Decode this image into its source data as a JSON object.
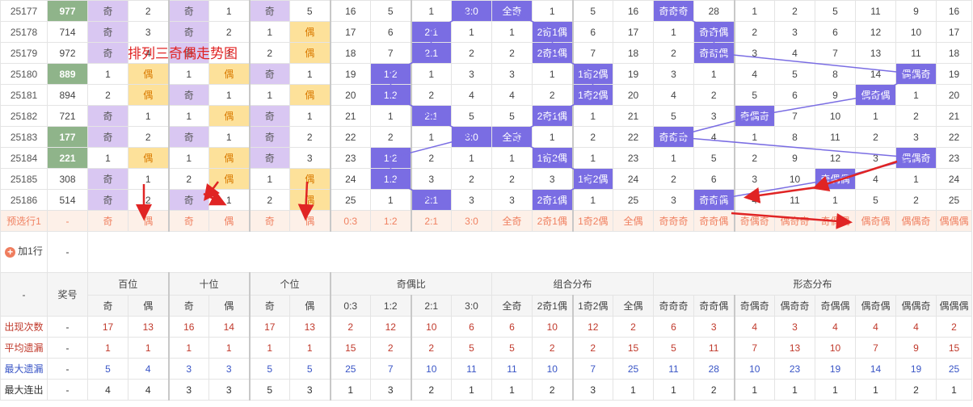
{
  "chart_title": "排列三奇偶走势图",
  "add_row": {
    "label": "加1行",
    "value": "-"
  },
  "rows": [
    {
      "issue": "25177",
      "lucky": "977",
      "lucky_hl": true,
      "c": [
        "奇",
        "2",
        "奇",
        "1",
        "奇",
        "5",
        "16",
        "5",
        "1",
        "3:0",
        "全奇",
        "1",
        "5",
        "16",
        "奇奇奇",
        "28",
        "1",
        "2",
        "5",
        "11",
        "9",
        "16"
      ],
      "hl": [
        0,
        2,
        4,
        9,
        10,
        14
      ]
    },
    {
      "issue": "25178",
      "lucky": "714",
      "lucky_hl": false,
      "c": [
        "奇",
        "3",
        "奇",
        "2",
        "1",
        "偶",
        "17",
        "6",
        "2:1",
        "1",
        "1",
        "2奇1偶",
        "6",
        "17",
        "1",
        "奇奇偶",
        "2",
        "3",
        "6",
        "12",
        "10",
        "17"
      ],
      "hl": [
        0,
        2,
        5,
        8,
        11,
        15
      ]
    },
    {
      "issue": "25179",
      "lucky": "972",
      "lucky_hl": false,
      "c": [
        "奇",
        "4",
        "奇",
        "1",
        "2",
        "偶",
        "18",
        "7",
        "2:1",
        "2",
        "2",
        "2奇1偶",
        "7",
        "18",
        "2",
        "奇奇偶",
        "3",
        "4",
        "7",
        "13",
        "11",
        "18"
      ],
      "hl": [
        0,
        2,
        5,
        8,
        11,
        15
      ]
    },
    {
      "issue": "25180",
      "lucky": "889",
      "lucky_hl": true,
      "c": [
        "1",
        "偶",
        "1",
        "偶",
        "奇",
        "1",
        "19",
        "1:2",
        "1",
        "3",
        "3",
        "1",
        "1奇2偶",
        "19",
        "3",
        "1",
        "4",
        "5",
        "8",
        "14",
        "偶偶奇",
        "19"
      ],
      "hl": [
        1,
        3,
        4,
        7,
        12,
        20
      ]
    },
    {
      "issue": "25181",
      "lucky": "894",
      "lucky_hl": false,
      "c": [
        "2",
        "偶",
        "奇",
        "1",
        "1",
        "偶",
        "20",
        "1:2",
        "2",
        "4",
        "4",
        "2",
        "1奇2偶",
        "20",
        "4",
        "2",
        "5",
        "6",
        "9",
        "偶奇偶",
        "1",
        "20"
      ],
      "hl": [
        1,
        2,
        5,
        7,
        12,
        19
      ]
    },
    {
      "issue": "25182",
      "lucky": "721",
      "lucky_hl": false,
      "c": [
        "奇",
        "1",
        "1",
        "偶",
        "奇",
        "1",
        "21",
        "1",
        "2:1",
        "5",
        "5",
        "2奇1偶",
        "1",
        "21",
        "5",
        "3",
        "奇偶奇",
        "7",
        "10",
        "1",
        "2",
        "21"
      ],
      "hl": [
        0,
        3,
        4,
        8,
        11,
        16
      ]
    },
    {
      "issue": "25183",
      "lucky": "177",
      "lucky_hl": true,
      "c": [
        "奇",
        "2",
        "奇",
        "1",
        "奇",
        "2",
        "22",
        "2",
        "1",
        "3:0",
        "全奇",
        "1",
        "2",
        "22",
        "奇奇奇",
        "4",
        "1",
        "8",
        "11",
        "2",
        "3",
        "22"
      ],
      "hl": [
        0,
        2,
        4,
        9,
        10,
        14
      ]
    },
    {
      "issue": "25184",
      "lucky": "221",
      "lucky_hl": true,
      "c": [
        "1",
        "偶",
        "1",
        "偶",
        "奇",
        "3",
        "23",
        "1:2",
        "2",
        "1",
        "1",
        "1奇2偶",
        "1",
        "23",
        "1",
        "5",
        "2",
        "9",
        "12",
        "3",
        "偶偶奇",
        "23"
      ],
      "hl": [
        1,
        3,
        4,
        7,
        11,
        20
      ]
    },
    {
      "issue": "25185",
      "lucky": "308",
      "lucky_hl": false,
      "c": [
        "奇",
        "1",
        "2",
        "偶",
        "1",
        "偶",
        "24",
        "1:2",
        "3",
        "2",
        "2",
        "3",
        "1奇2偶",
        "24",
        "2",
        "6",
        "3",
        "10",
        "奇偶偶",
        "4",
        "1",
        "24"
      ],
      "hl": [
        0,
        3,
        5,
        7,
        12,
        18
      ]
    },
    {
      "issue": "25186",
      "lucky": "514",
      "lucky_hl": false,
      "c": [
        "奇",
        "2",
        "奇",
        "1",
        "2",
        "偶",
        "25",
        "1",
        "2:1",
        "3",
        "3",
        "2奇1偶",
        "1",
        "25",
        "3",
        "奇奇偶",
        "4",
        "11",
        "1",
        "5",
        "2",
        "25"
      ],
      "hl": [
        0,
        2,
        5,
        8,
        11,
        15
      ]
    }
  ],
  "select_row": {
    "label": "预选行1",
    "dash": "-",
    "c": [
      "奇",
      "偶",
      "奇",
      "偶",
      "奇",
      "偶",
      "0:3",
      "1:2",
      "2:1",
      "3:0",
      "全奇",
      "2奇1偶",
      "1奇2偶",
      "全偶",
      "奇奇奇",
      "奇奇偶",
      "奇偶奇",
      "偶奇奇",
      "奇偶偶",
      "偶奇偶",
      "偶偶奇",
      "偶偶偶"
    ]
  },
  "header": {
    "dash": "-",
    "prize": "奖号",
    "groups": [
      {
        "label": "百位",
        "span": 2
      },
      {
        "label": "十位",
        "span": 2
      },
      {
        "label": "个位",
        "span": 2
      },
      {
        "label": "奇偶比",
        "span": 4
      },
      {
        "label": "组合分布",
        "span": 4
      },
      {
        "label": "形态分布",
        "span": 8
      }
    ],
    "sub": [
      "奇",
      "偶",
      "奇",
      "偶",
      "奇",
      "偶",
      "0:3",
      "1:2",
      "2:1",
      "3:0",
      "全奇",
      "2奇1偶",
      "1奇2偶",
      "全偶",
      "奇奇奇",
      "奇奇偶",
      "奇偶奇",
      "偶奇奇",
      "奇偶偶",
      "偶奇偶",
      "偶偶奇",
      "偶偶偶"
    ]
  },
  "stats": [
    {
      "label": "出现次数",
      "dash": "-",
      "tone": "red",
      "v": [
        "17",
        "13",
        "16",
        "14",
        "17",
        "13",
        "2",
        "12",
        "10",
        "6",
        "6",
        "10",
        "12",
        "2",
        "6",
        "3",
        "4",
        "3",
        "4",
        "4",
        "4",
        "2"
      ]
    },
    {
      "label": "平均遗漏",
      "dash": "-",
      "tone": "red",
      "v": [
        "1",
        "1",
        "1",
        "1",
        "1",
        "1",
        "15",
        "2",
        "2",
        "5",
        "5",
        "2",
        "2",
        "15",
        "5",
        "11",
        "7",
        "13",
        "10",
        "7",
        "9",
        "15"
      ]
    },
    {
      "label": "最大遗漏",
      "dash": "-",
      "tone": "blue",
      "v": [
        "5",
        "4",
        "3",
        "3",
        "5",
        "5",
        "25",
        "7",
        "10",
        "11",
        "11",
        "10",
        "7",
        "25",
        "11",
        "28",
        "10",
        "23",
        "19",
        "14",
        "19",
        "25"
      ]
    },
    {
      "label": "最大连出",
      "dash": "-",
      "tone": "dark",
      "v": [
        "4",
        "4",
        "3",
        "3",
        "5",
        "3",
        "1",
        "3",
        "2",
        "1",
        "1",
        "2",
        "3",
        "1",
        "1",
        "2",
        "1",
        "1",
        "1",
        "1",
        "2",
        "1"
      ]
    }
  ]
}
